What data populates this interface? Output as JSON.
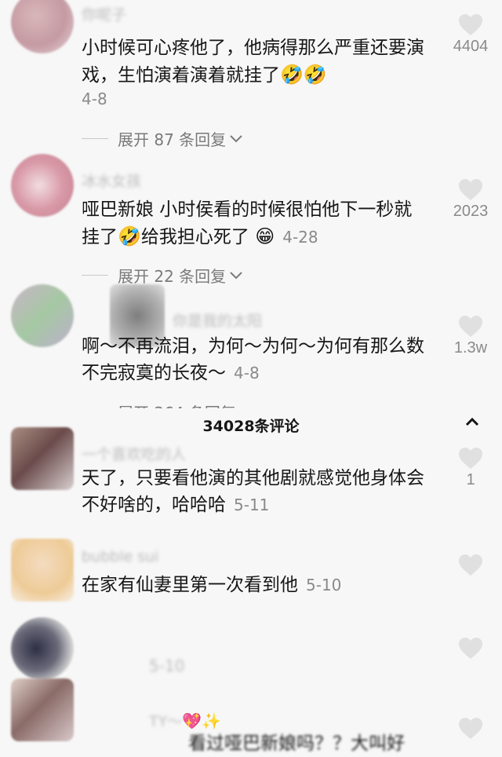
{
  "comments": [
    {
      "username": "你呢子",
      "text": "小时候可心疼他了，他病得那么严重还要演戏，生怕演着演着就挂了",
      "emoji": "🤣🤣",
      "date": "4-8",
      "likes": "4404",
      "replies": "展开 87 条回复"
    },
    {
      "username": "冰水女孩",
      "text": "哑巴新娘 小时侯看的时候很怕他下一秒就挂了",
      "emoji_mid": "🤣",
      "text2": "给我担心死了",
      "emoji": "😁",
      "date": "4-28",
      "likes": "2023",
      "replies": "展开 22 条回复"
    },
    {
      "username": "你是我的太阳",
      "text": "啊～不再流泪，为何～为何～为何有那么数不完寂寞的长夜～",
      "date": "4-8",
      "likes": "1.3w",
      "replies": "展开 364 条回复"
    },
    {
      "username": "一个喜欢吃的人",
      "text": "天了，只要看他演的其他剧就感觉他身体会不好啥的，哈哈哈",
      "date": "5-11",
      "likes": "1"
    },
    {
      "username": "bubble sui",
      "text": "在家有仙妻里第一次看到他",
      "date": "5-10"
    },
    {
      "username": "",
      "date": "5-10"
    },
    {
      "username": "TY～",
      "badge": "💖✨",
      "text": "看过哑巴新娘吗？？大叫好"
    }
  ],
  "header": {
    "title": "34028条评论",
    "close_icon": "chevron-up-icon"
  },
  "colors": {
    "background": "#f7f7f7",
    "text": "#161616",
    "meta": "#8a8a8a",
    "heart": "#e0e0e0"
  }
}
